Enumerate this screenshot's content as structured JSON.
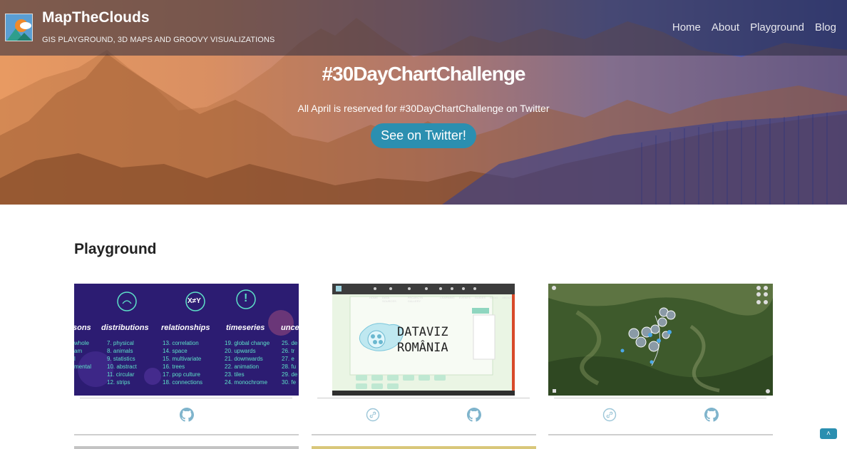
{
  "header": {
    "brand": "MapTheClouds",
    "tagline": "GIS PLAYGROUND, 3D MAPS AND GROOVY VISUALIZATIONS",
    "nav": [
      "Home",
      "About",
      "Playground",
      "Blog"
    ]
  },
  "hero": {
    "title": "#30DayChartChallenge",
    "subtitle": "All April is reserved for #30DayChartChallenge on Twitter",
    "button": "See on Twitter!"
  },
  "playground": {
    "title": "Playground",
    "cards": [
      {
        "thumb": {
          "headers": [
            "sons",
            "distributions",
            "relationships",
            "timeseries",
            "unce"
          ],
          "col0": [
            "whole",
            "am",
            "l",
            "",
            "mental"
          ],
          "col1": [
            "7.  physical",
            "8.  animals",
            "9.  statistics",
            "10. abstract",
            "11. circular",
            "12. strips"
          ],
          "col2": [
            "13. correlation",
            "14. space",
            "15. multivariate",
            "16. trees",
            "17. pop culture",
            "18. connections"
          ],
          "col3": [
            "19.  global change",
            "20. upwards",
            "21. downwards",
            "22. animation",
            "23. tiles",
            "24. monochrome"
          ],
          "col4": [
            "25. de",
            "26. tr",
            "27. e",
            "28. fu",
            "29. de",
            "30. fe"
          ],
          "symbols": [
            "X≠Y",
            "!"
          ]
        },
        "links": [
          "github"
        ]
      },
      {
        "thumb": {
          "title_line1": "DATAVIZ",
          "title_line2": "ROMÂNIA",
          "menu": [
            "HOME",
            "DATA SOURCES",
            "PROJECTS GALLERY",
            "LEARNING",
            "EVENTS",
            "GUIDES",
            "BLOG",
            "ABOUT"
          ]
        },
        "links": [
          "link",
          "github"
        ]
      },
      {
        "thumb": {
          "kind": "satellite map"
        },
        "links": [
          "link",
          "github"
        ]
      }
    ]
  },
  "colors": {
    "accent": "#2b8fb0",
    "navbar": "#3b3b52"
  },
  "icons": [
    "logo-icon",
    "github-icon",
    "link-icon",
    "chevron-up-icon"
  ],
  "scroll_top": "˄"
}
